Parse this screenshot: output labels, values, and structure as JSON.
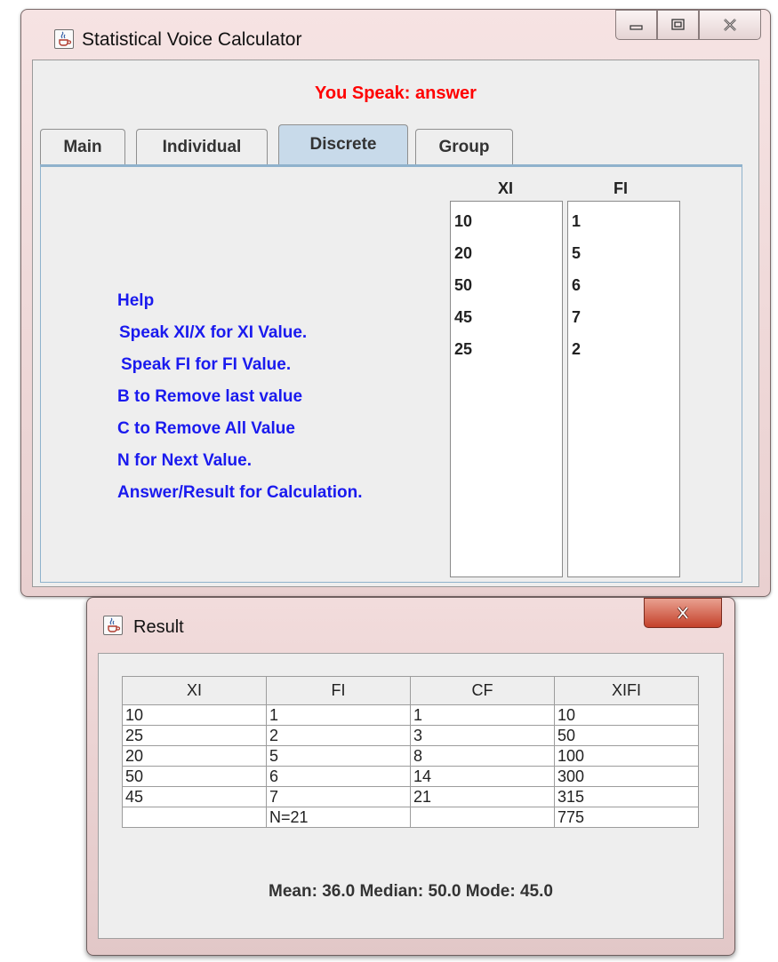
{
  "main_window": {
    "title": "Statistical Voice Calculator",
    "speak_status": "You Speak: answer",
    "tabs": [
      "Main",
      "Individual",
      "Discrete",
      "Group"
    ],
    "selected_tab": "Discrete",
    "help_lines": [
      "Help",
      "Speak XI/X for XI Value.",
      "Speak FI for FI Value.",
      "B to Remove last value",
      "C to Remove All Value",
      "N for Next Value.",
      "Answer/Result for Calculation."
    ],
    "xi_header": "XI",
    "fi_header": "FI",
    "xi_values": [
      "10",
      "20",
      "50",
      "45",
      "25"
    ],
    "fi_values": [
      "1",
      "5",
      "6",
      "7",
      "2"
    ]
  },
  "result_window": {
    "title": "Result",
    "columns": [
      "XI",
      "FI",
      "CF",
      "XIFI"
    ],
    "rows": [
      [
        "10",
        "1",
        "1",
        "10"
      ],
      [
        "25",
        "2",
        "3",
        "50"
      ],
      [
        "20",
        "5",
        "8",
        "100"
      ],
      [
        "50",
        "6",
        "14",
        "300"
      ],
      [
        "45",
        "7",
        "21",
        "315"
      ],
      [
        "",
        "N=21",
        "",
        "775"
      ]
    ],
    "summary": "Mean: 36.0 Median: 50.0 Mode: 45.0"
  },
  "colors": {
    "speak_status": "#ff0000",
    "help_text": "#1a1aee",
    "selected_tab": "#c8daea",
    "close_button": "#c4402a"
  },
  "icons": [
    "java-coffee-icon",
    "minimize-icon",
    "maximize-icon",
    "close-icon"
  ]
}
